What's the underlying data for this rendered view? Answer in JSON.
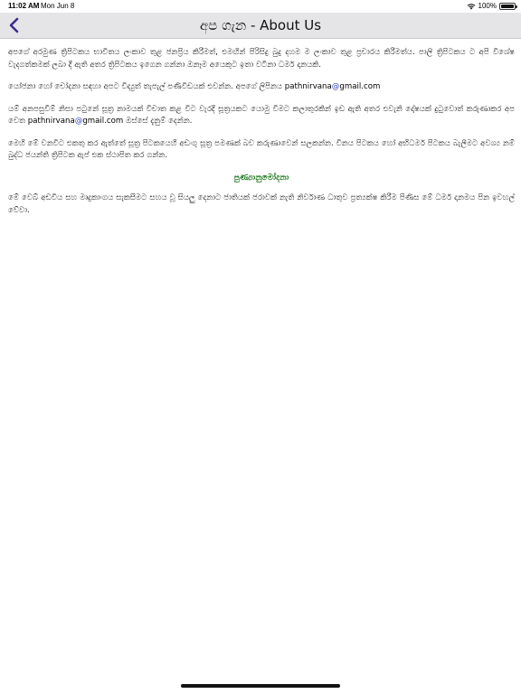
{
  "status_bar": {
    "time": "11:02 AM",
    "date": "Mon Jun 8",
    "battery": "100%"
  },
  "nav": {
    "title": "අප ගැන - About Us",
    "back_icon": "chevron-left-icon",
    "accent_color": "#3c2d8f"
  },
  "content": {
    "paragraph_1": "අපගේ අරමුණ ත්‍රිපිටකය භාවිතය ලංකාව තුළ ජනප්‍රිය කිරීමත්, එමඟින් පිරිසිදු බුදු දහම ම ලංකාව තුළ ප්‍රචාරය කිරීමත්ය. පාලි ත්‍රිපිටකය ට අපි විශේෂ වැදගත්කමක් ලබා දී ඇති අතර ත්‍රිපිටකය ඉගෙන ගන්නා ඔනෑම අයෙකුට ඉතා වටිනා ධර්ම දානයකි.",
    "paragraph_2_text": "යෝජනා හෝ චෝදනා සඳහා අපට විද්‍යුත් තැපැල් පණිවිඩයක් එවන්න. අපගේ ලිපිනය ",
    "email_user": "pathnirvana",
    "email_at": "@",
    "email_domain": "gmail.com",
    "paragraph_3_text_a": "යම් අනපසුවීම් නිසා පටුනේ සූත්‍ර නාමයක් විචාත කළ විට වැරදි සූත්‍රයකට යොමු වීමට කලාතුරකින් ඉඩ ඇති අතර එවැනි දෝෂයක් දුටුවොත් කරුණාකර අප වෙත ",
    "paragraph_3_text_b": " ඔස්සේ දැනුම් දෙන්න.",
    "paragraph_4": "මෙහි මේ වනවිට එකතු කර ඇත්තේ සූත්‍ර පිටකයෙහි අඩංගු සූත්‍ර පමණක් බව කරුණාවෙන් සලකන්න. විනය පිටකය හෝ අභිධර්ම පිටකය බැලීමට අවශ්‍ය නම් බුද්ධ ජයන්ති ත්‍රිපිටක ඇප් එක ස්ථාපිත කර ගන්න.",
    "blessing_heading": "පුණ්‍යානුමෝදනා",
    "paragraph_5": "මේ වෙබ් අඩවිය සහ මෘදුකාංගය සැකසීමට සහය වූ සියලු දෙනාට ජාතියක් ජරාවක් නැති නිර්වාණ ධාතුව ප්‍රත්‍යක්ෂ කිරීම පිණිස මේ ධර්ම දානමය පින ඉවහල් වේවා.",
    "blessing_color": "#1f7a1f",
    "link_color": "#3346b8"
  }
}
